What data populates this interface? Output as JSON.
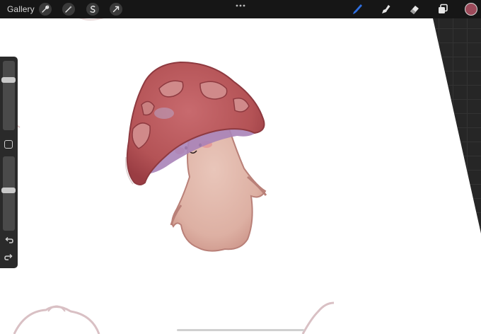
{
  "topbar": {
    "gallery_label": "Gallery",
    "left_tools": [
      "wrench-icon",
      "magic-wand-icon",
      "selection-s-icon",
      "transform-arrow-icon"
    ],
    "right_tools": [
      "brush-icon",
      "smudge-icon",
      "eraser-icon",
      "layers-icon"
    ],
    "active_tool": "brush-icon",
    "current_color": "#9c4a5a",
    "accent_color": "#2f6fe0"
  },
  "sidebar": {
    "brush_size_level": 0.75,
    "opacity_level": 0.55,
    "controls": [
      "brush-size-slider",
      "modify-button",
      "opacity-slider",
      "undo-icon",
      "redo-icon"
    ]
  }
}
